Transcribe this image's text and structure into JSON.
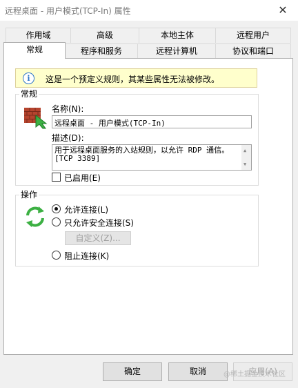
{
  "window": {
    "title": "远程桌面 - 用户模式(TCP-In) 属性",
    "close_glyph": "✕"
  },
  "tabs_back": [
    "作用域",
    "高级",
    "本地主体",
    "远程用户"
  ],
  "tabs_front": [
    "常规",
    "程序和服务",
    "远程计算机",
    "协议和端口"
  ],
  "info": {
    "icon": "info-icon",
    "glyph": "i",
    "text": "这是一个预定义规则，其某些属性无法被修改。"
  },
  "general": {
    "group_title": "常规",
    "icon": "firewall-brick-icon",
    "name_label": "名称(N):",
    "name_value": "远程桌面 - 用户模式(TCP-In)",
    "desc_label": "描述(D):",
    "desc_lines": [
      "用于远程桌面服务的入站规则，以允许 RDP 通信。",
      "[TCP 3389]"
    ],
    "enabled_label": "已启用(E)",
    "enabled_checked": false
  },
  "action": {
    "group_title": "操作",
    "icon": "refresh-arrows-icon",
    "options": [
      {
        "label": "允许连接(L)",
        "selected": true
      },
      {
        "label": "只允许安全连接(S)",
        "selected": false
      },
      {
        "label": "阻止连接(K)",
        "selected": false
      }
    ],
    "customize_label": "自定义(Z)..."
  },
  "buttons": {
    "ok": "确定",
    "cancel": "取消",
    "apply": "应用(A)"
  },
  "watermark": "@稀土掘金技术社区",
  "colors": {
    "info_bg": "#ffffcc",
    "info_icon": "#2e76c8",
    "arrow_green": "#3cb043",
    "brick_red": "#b5442e"
  }
}
